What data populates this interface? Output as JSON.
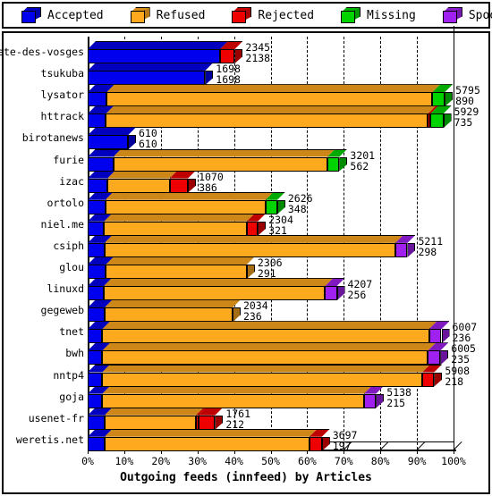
{
  "legend": {
    "items": [
      {
        "label": "Accepted",
        "color": "#0000EE",
        "icon": "cube-icon"
      },
      {
        "label": "Refused",
        "color": "#FFA91E",
        "icon": "cube-icon"
      },
      {
        "label": "Rejected",
        "color": "#EE0000",
        "icon": "cube-icon"
      },
      {
        "label": "Missing",
        "color": "#00D400",
        "icon": "cube-icon"
      },
      {
        "label": "Spooled",
        "color": "#A020F0",
        "icon": "cube-icon"
      }
    ]
  },
  "chart_data": {
    "type": "bar",
    "orientation": "horizontal",
    "stacked": true,
    "title": "Outgoing feeds (innfeed) by Articles",
    "xlabel": "Outgoing feeds (innfeed) by Articles",
    "ylabel": "",
    "xlim": [
      0,
      100
    ],
    "xunit": "%",
    "grid": true,
    "legend_position": "top",
    "xticklabels": [
      "0%",
      "10%",
      "20%",
      "30%",
      "40%",
      "50%",
      "60%",
      "70%",
      "80%",
      "90%",
      "100%"
    ],
    "xtickvalues": [
      0,
      10,
      20,
      30,
      40,
      50,
      60,
      70,
      80,
      90,
      100
    ],
    "series_names": [
      "Accepted",
      "Refused",
      "Rejected",
      "Missing",
      "Spooled"
    ],
    "series_colors": [
      "#0000EE",
      "#FFA91E",
      "#EE0000",
      "#00D400",
      "#A020F0"
    ],
    "categories": [
      "bete-des-vosges",
      "tsukuba",
      "lysator",
      "httrack",
      "birotanews",
      "furie",
      "izac",
      "ortolo",
      "niel.me",
      "csiph",
      "glou",
      "linuxd",
      "gegeweb",
      "tnet",
      "bwh",
      "nntp4",
      "goja",
      "usenet-fr",
      "weretis.net"
    ],
    "rows": [
      {
        "label": "bete-des-vosges",
        "total": 2345,
        "label2": 2138,
        "segments": [
          {
            "name": "Accepted",
            "pct": 36.2
          },
          {
            "name": "Rejected",
            "pct": 4.0
          }
        ]
      },
      {
        "label": "tsukuba",
        "total": 1698,
        "label2": 1698,
        "segments": [
          {
            "name": "Accepted",
            "pct": 32.1
          }
        ]
      },
      {
        "label": "lysator",
        "total": 5795,
        "label2": 890,
        "segments": [
          {
            "name": "Accepted",
            "pct": 5.2
          },
          {
            "name": "Refused",
            "pct": 89.0
          },
          {
            "name": "Missing",
            "pct": 3.4
          }
        ]
      },
      {
        "label": "httrack",
        "total": 5929,
        "label2": 735,
        "segments": [
          {
            "name": "Accepted",
            "pct": 5.0
          },
          {
            "name": "Refused",
            "pct": 88.0
          },
          {
            "name": "Rejected",
            "pct": 0.7
          },
          {
            "name": "Missing",
            "pct": 3.5
          }
        ]
      },
      {
        "label": "birotanews",
        "total": 610,
        "label2": 610,
        "segments": [
          {
            "name": "Accepted",
            "pct": 11.0
          }
        ]
      },
      {
        "label": "furie",
        "total": 3201,
        "label2": 562,
        "segments": [
          {
            "name": "Accepted",
            "pct": 7.0
          },
          {
            "name": "Refused",
            "pct": 58.5
          },
          {
            "name": "Missing",
            "pct": 3.3
          }
        ]
      },
      {
        "label": "izac",
        "total": 1070,
        "label2": 386,
        "segments": [
          {
            "name": "Accepted",
            "pct": 5.4
          },
          {
            "name": "Refused",
            "pct": 17.0
          },
          {
            "name": "Rejected",
            "pct": 5.0
          }
        ]
      },
      {
        "label": "ortolo",
        "total": 2626,
        "label2": 348,
        "segments": [
          {
            "name": "Accepted",
            "pct": 4.8
          },
          {
            "name": "Refused",
            "pct": 43.8
          },
          {
            "name": "Missing",
            "pct": 3.2
          }
        ]
      },
      {
        "label": "niel.me",
        "total": 2304,
        "label2": 321,
        "segments": [
          {
            "name": "Accepted",
            "pct": 4.5
          },
          {
            "name": "Refused",
            "pct": 39.0
          },
          {
            "name": "Rejected",
            "pct": 3.0
          }
        ]
      },
      {
        "label": "csiph",
        "total": 5211,
        "label2": 298,
        "segments": [
          {
            "name": "Accepted",
            "pct": 4.6
          },
          {
            "name": "Refused",
            "pct": 79.5
          },
          {
            "name": "Spooled",
            "pct": 3.3
          }
        ]
      },
      {
        "label": "glou",
        "total": 2306,
        "label2": 291,
        "segments": [
          {
            "name": "Accepted",
            "pct": 5.0
          },
          {
            "name": "Refused",
            "pct": 38.5
          }
        ]
      },
      {
        "label": "linuxd",
        "total": 4207,
        "label2": 256,
        "segments": [
          {
            "name": "Accepted",
            "pct": 4.4
          },
          {
            "name": "Refused",
            "pct": 60.5
          },
          {
            "name": "Spooled",
            "pct": 3.2
          }
        ]
      },
      {
        "label": "gegeweb",
        "total": 2034,
        "label2": 236,
        "segments": [
          {
            "name": "Accepted",
            "pct": 4.6
          },
          {
            "name": "Refused",
            "pct": 35.0
          }
        ]
      },
      {
        "label": "tnet",
        "total": 6007,
        "label2": 236,
        "segments": [
          {
            "name": "Accepted",
            "pct": 4.0
          },
          {
            "name": "Refused",
            "pct": 89.3
          },
          {
            "name": "Spooled",
            "pct": 3.4
          }
        ]
      },
      {
        "label": "bwh",
        "total": 6005,
        "label2": 235,
        "segments": [
          {
            "name": "Accepted",
            "pct": 4.0
          },
          {
            "name": "Refused",
            "pct": 89.0
          },
          {
            "name": "Spooled",
            "pct": 3.4
          }
        ]
      },
      {
        "label": "nntp4",
        "total": 5908,
        "label2": 218,
        "segments": [
          {
            "name": "Accepted",
            "pct": 4.0
          },
          {
            "name": "Refused",
            "pct": 87.5
          },
          {
            "name": "Rejected",
            "pct": 3.2
          }
        ]
      },
      {
        "label": "goja",
        "total": 5138,
        "label2": 215,
        "segments": [
          {
            "name": "Accepted",
            "pct": 4.0
          },
          {
            "name": "Refused",
            "pct": 71.5
          },
          {
            "name": "Spooled",
            "pct": 3.3
          }
        ]
      },
      {
        "label": "usenet-fr",
        "total": 1761,
        "label2": 212,
        "segments": [
          {
            "name": "Accepted",
            "pct": 4.6
          },
          {
            "name": "Refused",
            "pct": 25.0
          },
          {
            "name": "Rejected",
            "pct": 0.6
          },
          {
            "name": "Rejected2",
            "pct": 4.6
          }
        ]
      },
      {
        "label": "weretis.net",
        "total": 3697,
        "label2": 197,
        "segments": [
          {
            "name": "Accepted",
            "pct": 4.6
          },
          {
            "name": "Refused",
            "pct": 56.0
          },
          {
            "name": "Rejected",
            "pct": 3.4
          }
        ]
      }
    ]
  }
}
